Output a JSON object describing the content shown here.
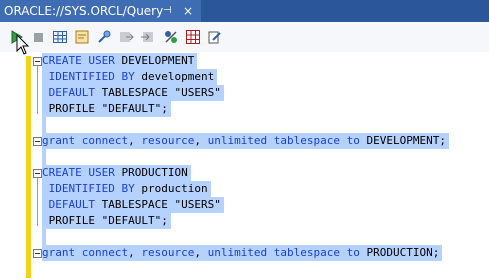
{
  "tab": {
    "title": "ORACLE://SYS.ORCL/Query",
    "pin": "⊣",
    "close": "×"
  },
  "toolbar": {
    "buttons": [
      "run-icon",
      "stop-icon",
      "grid-icon",
      "explain-plan-icon",
      "settings-icon",
      "export-icon",
      "import-icon",
      "format-icon",
      "table-icon",
      "edit-icon"
    ]
  },
  "colors": {
    "tab_bg": "#3e6db3",
    "selection": "#b5d2ff",
    "keyword": "#1a3fd1",
    "margin_bar": "#f2d21b"
  },
  "code": {
    "l1": {
      "k1": "CREATE USER",
      "t1": " DEVELOPMENT"
    },
    "l2": {
      "k1": " IDENTIFIED BY",
      "t1": " development"
    },
    "l3": {
      "k1": " DEFAULT",
      "t1": " TABLESPACE \"USERS\""
    },
    "l4": {
      "t1": " PROFILE \"DEFAULT\";"
    },
    "l5": {
      "k1": "grant connect",
      "t1": ",",
      "k2": " resource",
      "t2": ",",
      "k3": " unlimited tablespace to",
      "t3": " DEVELOPMENT;"
    },
    "l6": {
      "k1": "CREATE USER",
      "t1": " PRODUCTION"
    },
    "l7": {
      "k1": " IDENTIFIED BY",
      "t1": " production"
    },
    "l8": {
      "k1": " DEFAULT",
      "t1": " TABLESPACE \"USERS\""
    },
    "l9": {
      "t1": " PROFILE \"DEFAULT\";"
    },
    "l10": {
      "k1": "grant connect",
      "t1": ",",
      "k2": " resource",
      "t2": ",",
      "k3": " unlimited tablespace to",
      "t3": " PRODUCTION;"
    }
  }
}
